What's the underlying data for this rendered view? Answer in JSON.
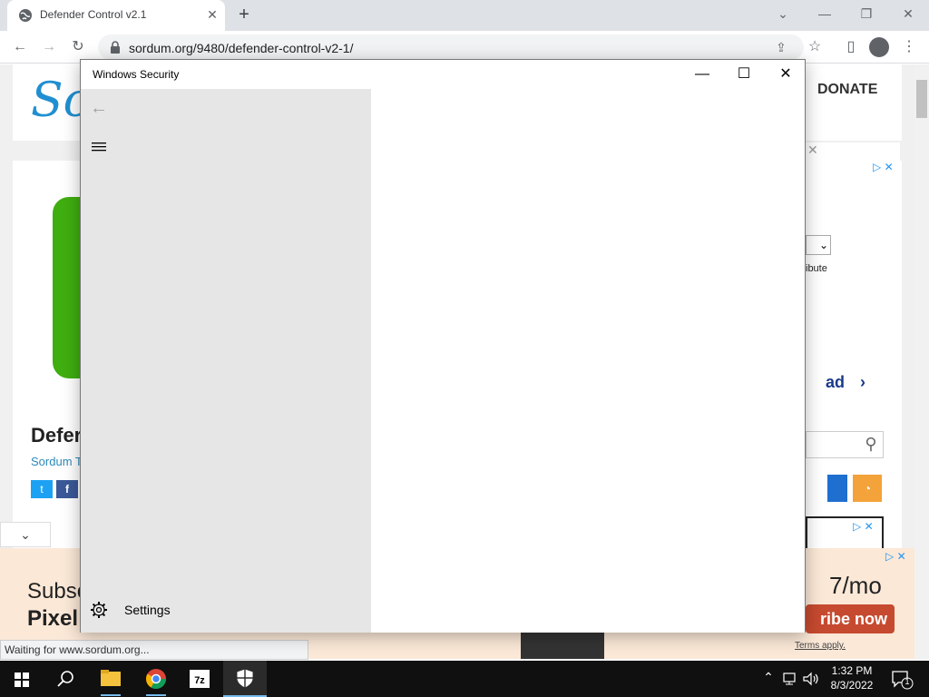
{
  "browser": {
    "tab_title": "Defender Control v2.1",
    "tab_close": "✕",
    "new_tab": "+",
    "url": "sordum.org/9480/defender-control-v2-1/",
    "status_text": "Waiting for www.sordum.org..."
  },
  "site": {
    "logo_text": "So",
    "donate": "DONATE",
    "post_title_partial": "Defer",
    "post_author_partial": "Sordum T",
    "download_partial": "ad",
    "ad_subscribe_partial": "Subsc",
    "ad_pixel_partial": "Pixel",
    "ad_price_partial": "7/mo",
    "ad_cta_partial": "ribe now",
    "ad_terms": "Terms apply.",
    "attribute_partial": "ibute"
  },
  "ws": {
    "title": "Windows Security",
    "settings_label": "Settings"
  },
  "taskbar": {
    "time": "1:32 PM",
    "date": "8/3/2022",
    "notification_count": "1"
  },
  "colors": {
    "chrome_tabstrip": "#dee1e6",
    "ws_nav": "#e6e6e6",
    "taskbar": "#101010",
    "accent": "#76b9ed"
  }
}
